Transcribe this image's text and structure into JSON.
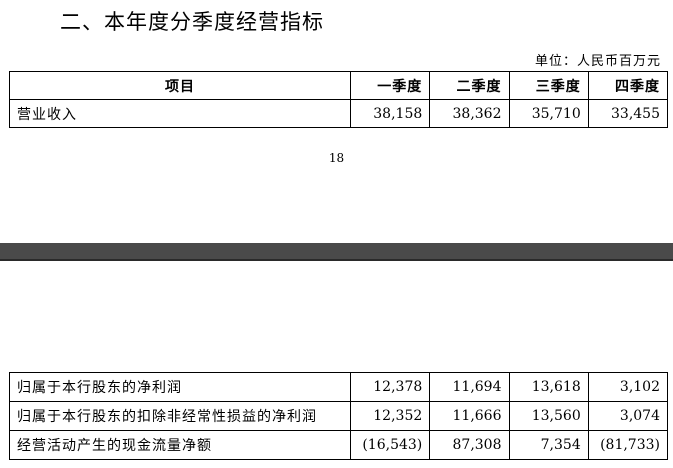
{
  "section_title": "二、本年度分季度经营指标",
  "unit_label": "单位：人民币百万元",
  "table_top": {
    "headers": [
      "项目",
      "一季度",
      "二季度",
      "三季度",
      "四季度"
    ],
    "rows": [
      {
        "label": "营业收入",
        "values": [
          "38,158",
          "38,362",
          "35,710",
          "33,455"
        ]
      }
    ]
  },
  "page_number": "18",
  "table_bottom": {
    "rows": [
      {
        "label": "归属于本行股东的净利润",
        "values": [
          "12,378",
          "11,694",
          "13,618",
          "3,102"
        ]
      },
      {
        "label": "归属于本行股东的扣除非经常性损益的净利润",
        "values": [
          "12,352",
          "11,666",
          "13,560",
          "3,074"
        ]
      },
      {
        "label": "经营活动产生的现金流量净额",
        "values": [
          "(16,543)",
          "87,308",
          "7,354",
          "(81,733)"
        ]
      }
    ]
  }
}
